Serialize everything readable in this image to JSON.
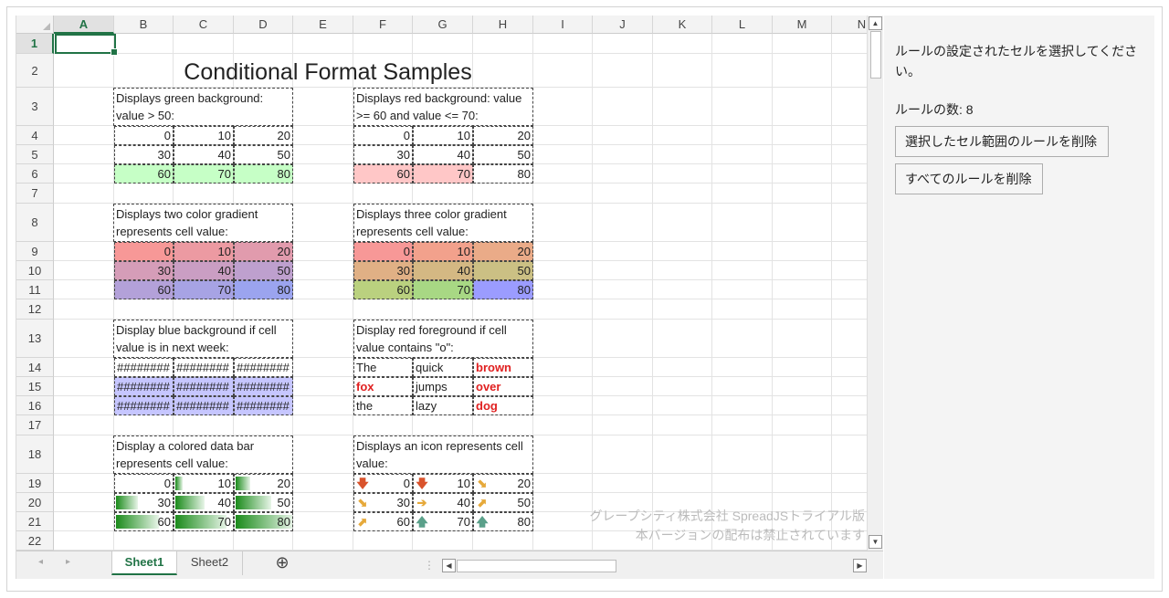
{
  "sheet": {
    "columns": [
      "A",
      "B",
      "C",
      "D",
      "E",
      "F",
      "G",
      "H",
      "I",
      "J",
      "K",
      "L",
      "M",
      "N"
    ],
    "rows": [
      "1",
      "2",
      "3",
      "4",
      "5",
      "6",
      "7",
      "8",
      "9",
      "10",
      "11",
      "12",
      "13",
      "14",
      "15",
      "16",
      "17",
      "18",
      "19",
      "20",
      "21",
      "22"
    ],
    "selected_column": "A",
    "selected_row": "1",
    "title": "Conditional Format Samples",
    "notes": {
      "green_bg": "Displays green background: value > 50:",
      "red_bg": "Displays red background: value >= 60 and value <= 70:",
      "two_color": "Displays two color gradient represents cell value:",
      "three_color": "Displays three color gradient represents cell value:",
      "blue_bg": "Display blue background if cell value is in next week:",
      "red_fg": "Display red foreground if cell value contains \"o\":",
      "data_bar": "Display a colored data bar represents cell value:",
      "icon": "Displays an icon represents cell value:"
    },
    "values": [
      "0",
      "10",
      "20",
      "30",
      "40",
      "50",
      "60",
      "70",
      "80"
    ],
    "hash": "########",
    "words": [
      "The",
      "quick",
      "brown",
      "fox",
      "jumps",
      "over",
      "the",
      "lazy",
      "dog"
    ],
    "watermark_line1": "グレープシティ株式会社 SpreadJSトライアル版",
    "watermark_line2": "本バージョンの配布は禁止されています",
    "colors": {
      "green_fill": "#c6ffc6",
      "red_fill": "#ffc7c7",
      "blue_fill": "#c6c6ff",
      "red_text": "#e02020",
      "accent": "#217346"
    }
  },
  "tabs": {
    "sheet1": "Sheet1",
    "sheet2": "Sheet2",
    "add": "⊕"
  },
  "panel": {
    "instruction": "ルールの設定されたセルを選択してください。",
    "rule_count_label": "ルールの数: 8",
    "delete_selected_button": "選択したセル範囲のルールを削除",
    "delete_all_button": "すべてのルールを削除"
  }
}
